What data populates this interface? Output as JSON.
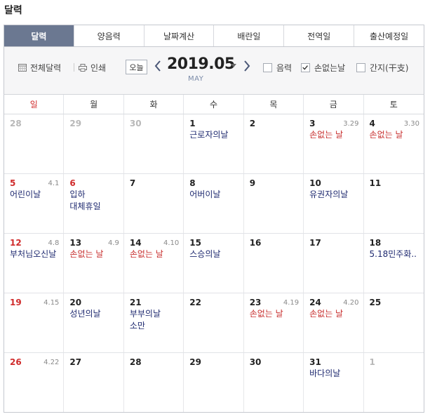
{
  "page_title": "달력",
  "tabs": [
    {
      "label": "달력",
      "active": true
    },
    {
      "label": "양음력",
      "active": false
    },
    {
      "label": "날짜계산",
      "active": false
    },
    {
      "label": "배란일",
      "active": false
    },
    {
      "label": "전역일",
      "active": false
    },
    {
      "label": "출산예정일",
      "active": false
    }
  ],
  "toolbar": {
    "full_calendar_label": "전체달력",
    "print_label": "인쇄",
    "today_label": "오늘",
    "month": "2019.05",
    "month_sub": "MAY",
    "checkboxes": [
      {
        "label": "음력",
        "checked": false
      },
      {
        "label": "손없는날",
        "checked": true
      },
      {
        "label": "간지(干支)",
        "checked": false
      }
    ]
  },
  "weekdays": [
    "일",
    "월",
    "화",
    "수",
    "목",
    "금",
    "토"
  ],
  "weeks": [
    [
      {
        "num": "28",
        "other": true,
        "lunar": "",
        "events": []
      },
      {
        "num": "29",
        "other": true,
        "lunar": "",
        "events": []
      },
      {
        "num": "30",
        "other": true,
        "lunar": "",
        "events": []
      },
      {
        "num": "1",
        "lunar": "",
        "events": [
          {
            "text": "근로자의날",
            "red": false
          }
        ]
      },
      {
        "num": "2",
        "lunar": "",
        "events": []
      },
      {
        "num": "3",
        "lunar": "3.29",
        "events": [
          {
            "text": "손없는 날",
            "red": true
          }
        ]
      },
      {
        "num": "4",
        "lunar": "3.30",
        "events": [
          {
            "text": "손없는 날",
            "red": true
          }
        ]
      }
    ],
    [
      {
        "num": "5",
        "lunar": "4.1",
        "events": [
          {
            "text": "어린이날",
            "red": false
          }
        ]
      },
      {
        "num": "6",
        "holiday": true,
        "lunar": "",
        "events": [
          {
            "text": "입하",
            "red": false
          },
          {
            "text": "대체휴일",
            "red": false
          }
        ]
      },
      {
        "num": "7",
        "lunar": "",
        "events": []
      },
      {
        "num": "8",
        "lunar": "",
        "events": [
          {
            "text": "어버이날",
            "red": false
          }
        ]
      },
      {
        "num": "9",
        "lunar": "",
        "events": []
      },
      {
        "num": "10",
        "lunar": "",
        "events": [
          {
            "text": "유권자의날",
            "red": false
          }
        ]
      },
      {
        "num": "11",
        "lunar": "",
        "events": []
      }
    ],
    [
      {
        "num": "12",
        "lunar": "4.8",
        "events": [
          {
            "text": "부처님오신날",
            "red": false
          }
        ]
      },
      {
        "num": "13",
        "lunar": "4.9",
        "events": [
          {
            "text": "손없는 날",
            "red": true
          }
        ]
      },
      {
        "num": "14",
        "lunar": "4.10",
        "events": [
          {
            "text": "손없는 날",
            "red": true
          }
        ]
      },
      {
        "num": "15",
        "lunar": "",
        "events": [
          {
            "text": "스승의날",
            "red": false
          }
        ]
      },
      {
        "num": "16",
        "lunar": "",
        "events": []
      },
      {
        "num": "17",
        "lunar": "",
        "events": []
      },
      {
        "num": "18",
        "lunar": "",
        "events": [
          {
            "text": "5.18민주화..",
            "red": false
          }
        ]
      }
    ],
    [
      {
        "num": "19",
        "lunar": "4.15",
        "events": []
      },
      {
        "num": "20",
        "lunar": "",
        "events": [
          {
            "text": "성년의날",
            "red": false
          }
        ]
      },
      {
        "num": "21",
        "lunar": "",
        "events": [
          {
            "text": "부부의날",
            "red": false
          },
          {
            "text": "소만",
            "red": false
          }
        ]
      },
      {
        "num": "22",
        "lunar": "",
        "events": []
      },
      {
        "num": "23",
        "lunar": "4.19",
        "events": [
          {
            "text": "손없는 날",
            "red": true
          }
        ]
      },
      {
        "num": "24",
        "lunar": "4.20",
        "events": [
          {
            "text": "손없는 날",
            "red": true
          }
        ]
      },
      {
        "num": "25",
        "lunar": "",
        "events": []
      }
    ],
    [
      {
        "num": "26",
        "lunar": "4.22",
        "events": []
      },
      {
        "num": "27",
        "lunar": "",
        "events": []
      },
      {
        "num": "28",
        "lunar": "",
        "events": []
      },
      {
        "num": "29",
        "lunar": "",
        "events": []
      },
      {
        "num": "30",
        "lunar": "",
        "events": []
      },
      {
        "num": "31",
        "lunar": "",
        "events": [
          {
            "text": "바다의날",
            "red": false
          }
        ]
      },
      {
        "num": "1",
        "other": true,
        "lunar": "",
        "events": []
      }
    ]
  ],
  "colors": {
    "tab_active": "#6b7891",
    "sunday": "#d02c2c",
    "event": "#1f2a70",
    "son_eomneun": "#c8302f"
  }
}
